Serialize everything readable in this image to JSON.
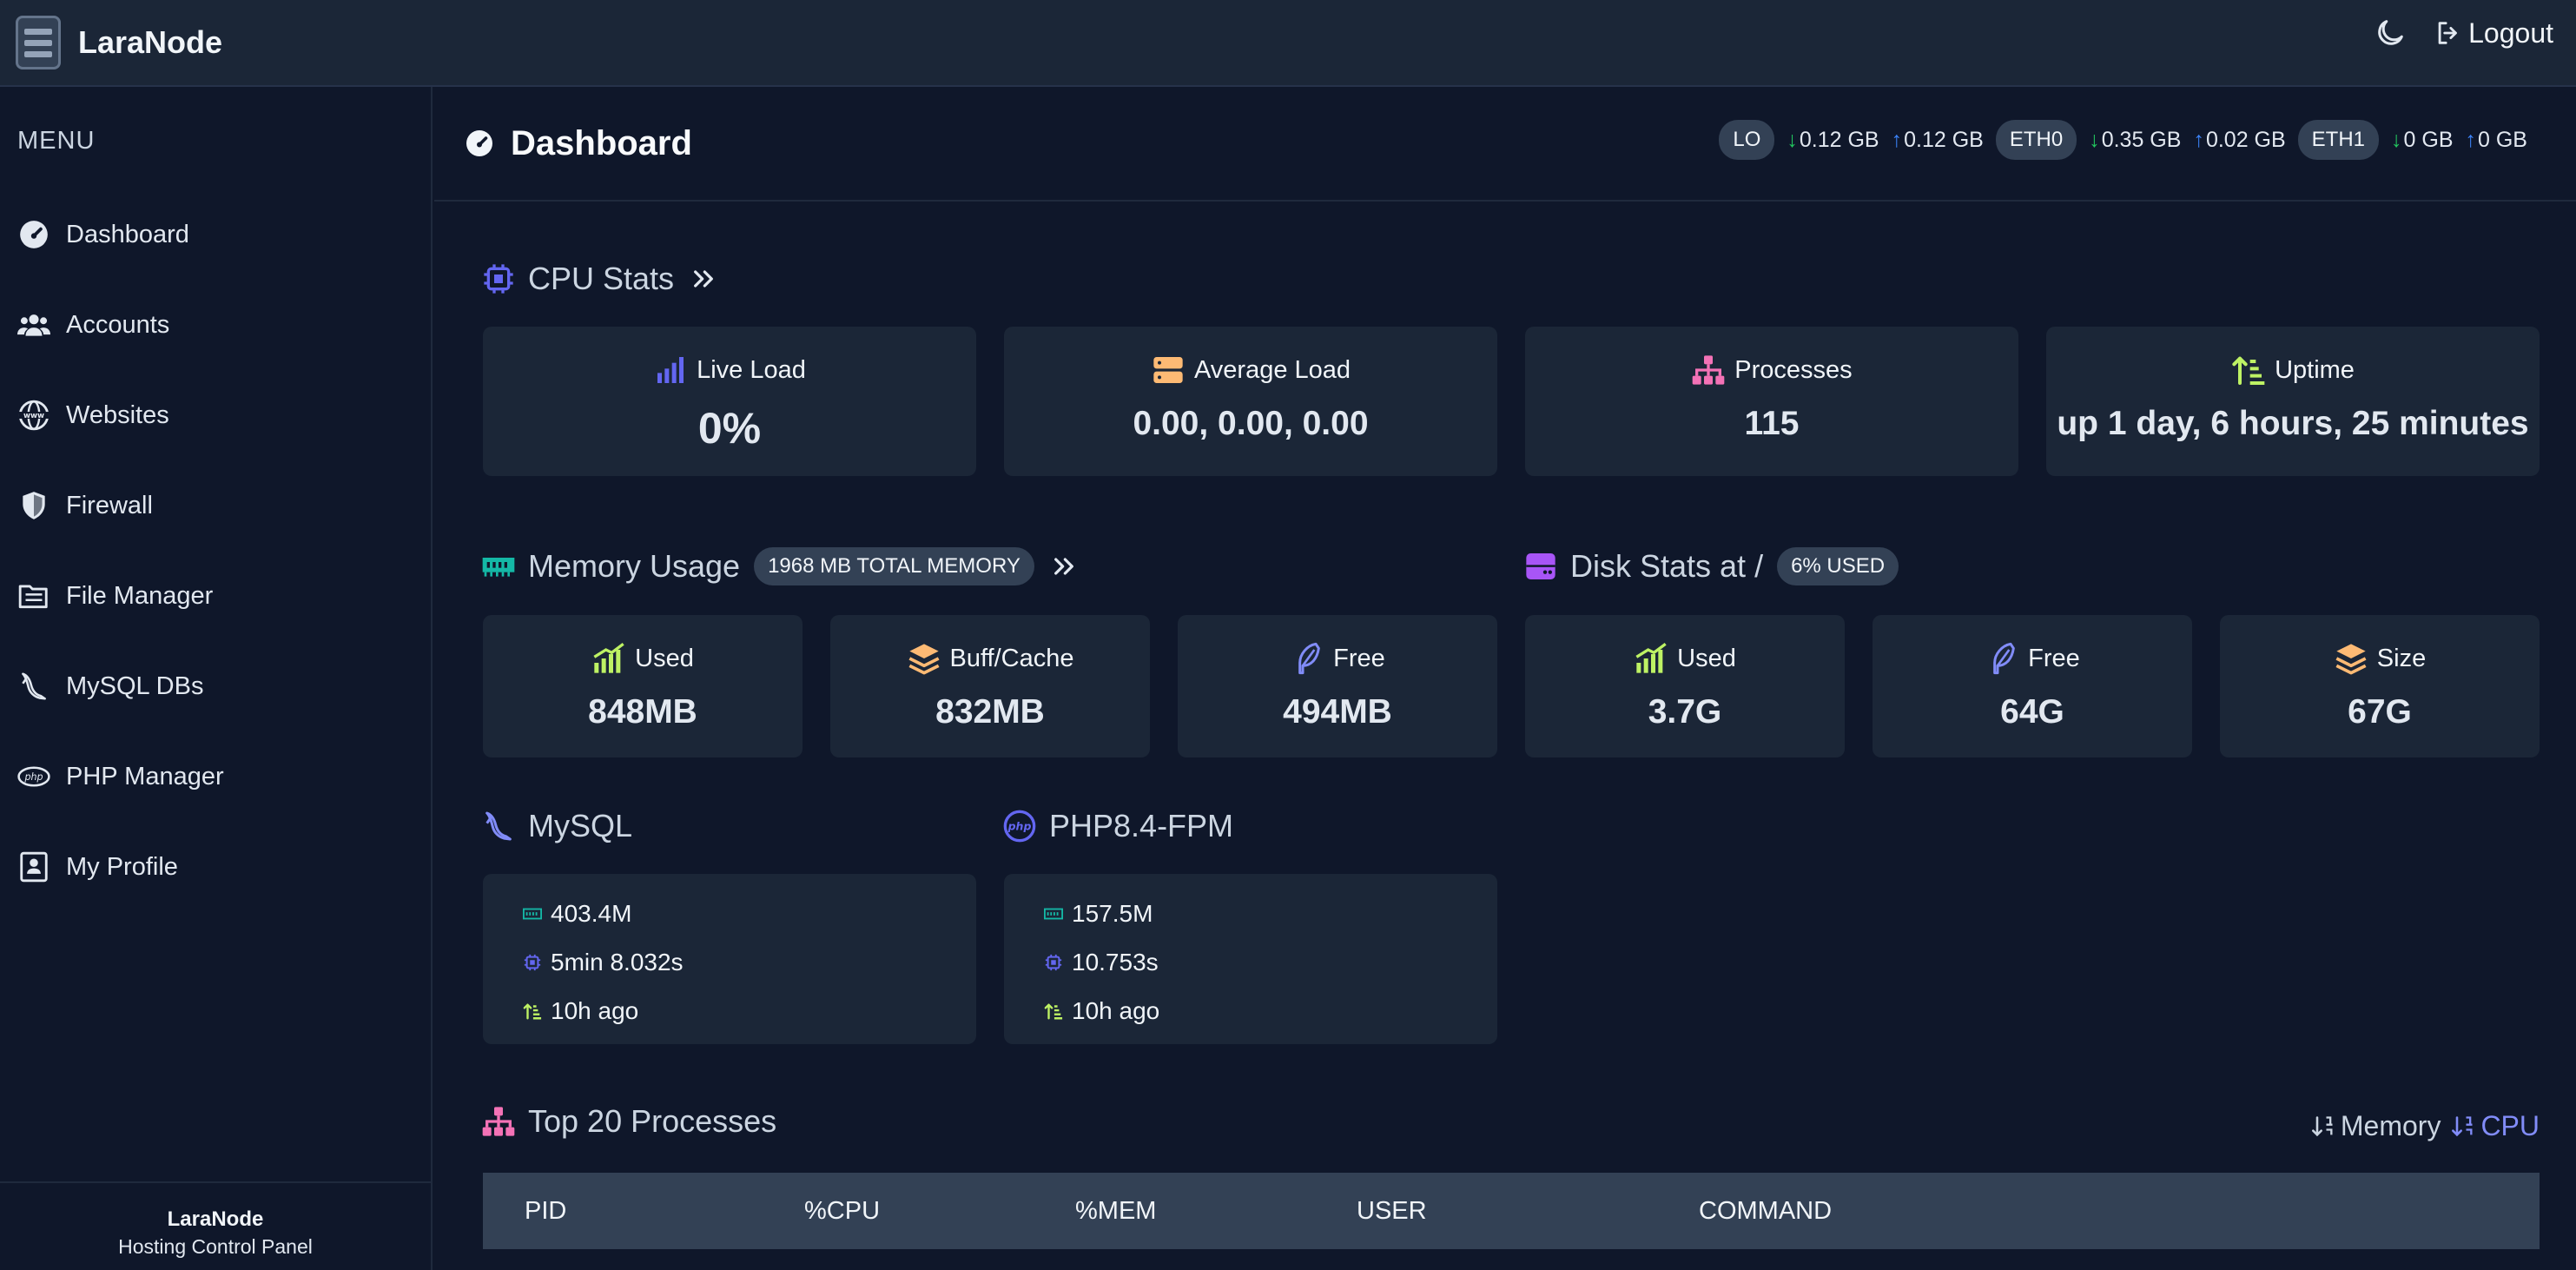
{
  "app": {
    "brand": "LaraNode",
    "logout_label": "Logout"
  },
  "sidebar": {
    "menu_title": "MENU",
    "items": [
      {
        "label": "Dashboard",
        "icon": "gauge-icon"
      },
      {
        "label": "Accounts",
        "icon": "users-icon"
      },
      {
        "label": "Websites",
        "icon": "www-globe-icon"
      },
      {
        "label": "Firewall",
        "icon": "shield-icon"
      },
      {
        "label": "File Manager",
        "icon": "folder-tree-icon"
      },
      {
        "label": "MySQL DBs",
        "icon": "dolphin-icon"
      },
      {
        "label": "PHP Manager",
        "icon": "php-icon"
      },
      {
        "label": "My Profile",
        "icon": "profile-card-icon"
      }
    ],
    "footer_title": "LaraNode",
    "footer_subtitle": "Hosting Control Panel"
  },
  "header": {
    "title": "Dashboard",
    "network": [
      {
        "iface": "LO",
        "down": "0.12 GB",
        "up": "0.12 GB"
      },
      {
        "iface": "ETH0",
        "down": "0.35 GB",
        "up": "0.02 GB"
      },
      {
        "iface": "ETH1",
        "down": "0 GB",
        "up": "0 GB"
      }
    ]
  },
  "cpu": {
    "title": "CPU Stats",
    "live_load_label": "Live Load",
    "live_load_value": "0%",
    "avg_load_label": "Average Load",
    "avg_load_value": "0.00, 0.00, 0.00",
    "processes_label": "Processes",
    "processes_value": "115",
    "uptime_label": "Uptime",
    "uptime_value": "up 1 day, 6 hours, 25 minutes"
  },
  "memory": {
    "title": "Memory Usage",
    "badge": "1968 MB TOTAL MEMORY",
    "used_label": "Used",
    "used_value": "848MB",
    "cache_label": "Buff/Cache",
    "cache_value": "832MB",
    "free_label": "Free",
    "free_value": "494MB"
  },
  "disk": {
    "title": "Disk Stats at /",
    "badge": "6% USED",
    "used_label": "Used",
    "used_value": "3.7G",
    "free_label": "Free",
    "free_value": "64G",
    "size_label": "Size",
    "size_value": "67G"
  },
  "mysql": {
    "title": "MySQL",
    "memory": "403.4M",
    "cpu_time": "5min 8.032s",
    "uptime": "10h ago"
  },
  "php": {
    "title": "PHP8.4-FPM",
    "memory": "157.5M",
    "cpu_time": "10.753s",
    "uptime": "10h ago"
  },
  "processes": {
    "title": "Top 20 Processes",
    "sort_memory": "Memory",
    "sort_cpu": "CPU",
    "columns": [
      "PID",
      "%CPU",
      "%MEM",
      "USER",
      "COMMAND"
    ]
  },
  "colors": {
    "background": "#0f172a",
    "card": "#1b2637",
    "accent_indigo": "#6366f1",
    "accent_teal": "#14b8a6",
    "accent_pink": "#f472b6",
    "accent_orange": "#fdba74",
    "accent_lime": "#bef264",
    "accent_purple": "#a855f7"
  }
}
